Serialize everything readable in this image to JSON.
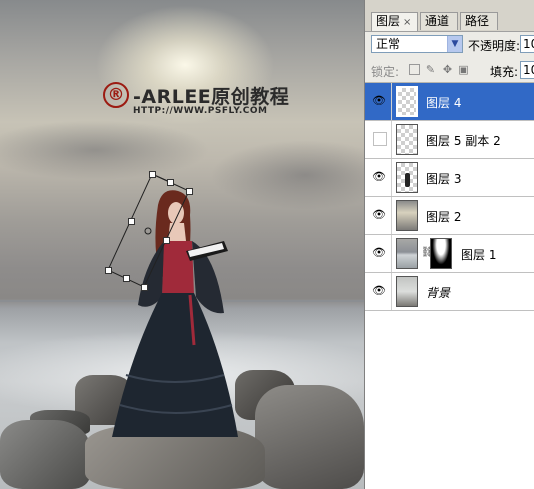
{
  "watermark": {
    "mark": "®",
    "name": "-ARLEE原创教程",
    "url": "HTTP://WWW.PSFLY.COM"
  },
  "panel": {
    "tabs": [
      {
        "label": "图层",
        "active": true,
        "close": "×"
      },
      {
        "label": "通道",
        "active": false
      },
      {
        "label": "路径",
        "active": false
      }
    ],
    "blend_mode": "正常",
    "opacity_label": "不透明度:",
    "opacity_value": "10",
    "lock_label": "锁定:",
    "fill_label": "填充:",
    "fill_value": "10"
  },
  "layers": [
    {
      "name": "图层 4",
      "visible": true,
      "selected": true,
      "thumb": "transparent"
    },
    {
      "name": "图层 5 副本 2",
      "visible": false,
      "selected": false,
      "thumb": "transparent"
    },
    {
      "name": "图层 3",
      "visible": true,
      "selected": false,
      "thumb": "figure"
    },
    {
      "name": "图层 2",
      "visible": true,
      "selected": false,
      "thumb": "sky"
    },
    {
      "name": "图层 1",
      "visible": true,
      "selected": false,
      "thumb": "sea",
      "has_mask": true
    },
    {
      "name": "背景",
      "visible": true,
      "selected": false,
      "thumb": "rock"
    }
  ],
  "colors": {
    "selection": "#3169c6",
    "watermark_red": "#9c1b12",
    "dress_red": "#a02a3a",
    "dress_dark": "#1e2630"
  }
}
